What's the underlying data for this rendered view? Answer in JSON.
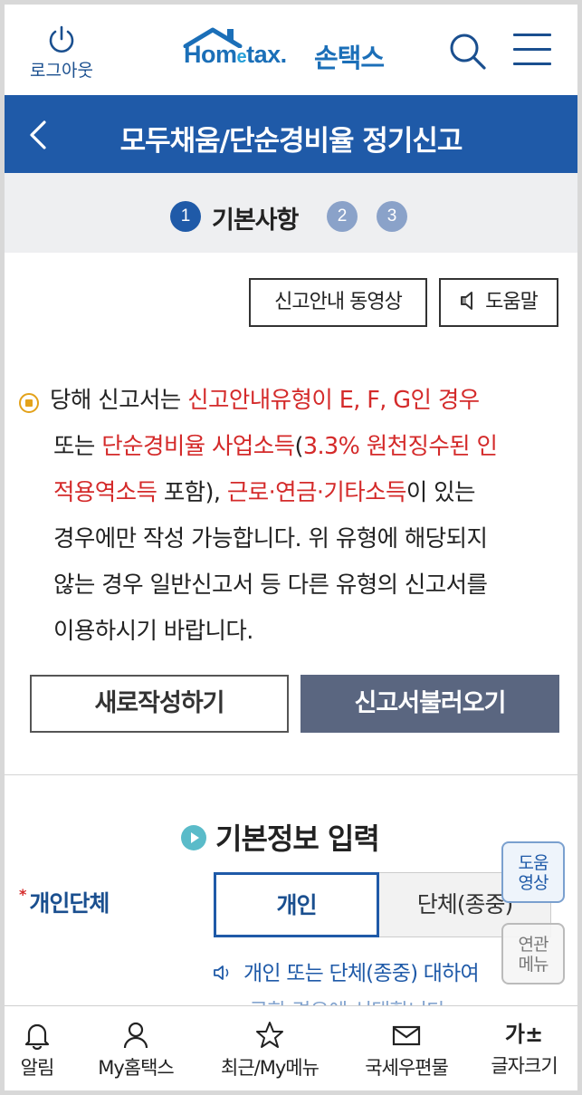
{
  "header": {
    "logout_label": "로그아웃",
    "logo_text_prefix": "Hom",
    "logo_text_e": "e",
    "logo_text_suffix": "tax.",
    "logo_son": "손택스",
    "search_icon": "search-icon",
    "menu_icon": "hamburger-menu-icon"
  },
  "title_bar": {
    "title": "모두채움/단순경비율 정기신고",
    "back_icon": "chevron-left-icon"
  },
  "steps": {
    "items": [
      {
        "number": "1",
        "label": "기본사항",
        "active": true
      },
      {
        "number": "2",
        "active": false
      },
      {
        "number": "3",
        "active": false
      }
    ]
  },
  "help": {
    "video_guide_label": "신고안내 동영상",
    "help_label": "도움말"
  },
  "notice": {
    "line1_a": "당해 신고서는 ",
    "line1_red": "신고안내유형이 E, F, G인 경우",
    "line2_a": "또는 ",
    "line2_red": "단순경비율 사업소득",
    "line2_b": "(",
    "line2_red2": "3.3% 원천징수된 인",
    "line3_red": "적용역소득",
    "line3_a": " 포함), ",
    "line3_red2": "근로·연금·기타소득",
    "line3_b": "이 있는",
    "line4": "경우에만 작성 가능합니다. 위 유형에 해당되지",
    "line5": "않는 경우 일반신고서 등 다른 유형의 신고서를",
    "line6": "이용하시기 바랍니다."
  },
  "actions": {
    "new_label": "새로작성하기",
    "load_label": "신고서불러오기"
  },
  "basic_info": {
    "title": "기본정보 입력",
    "field_label": "개인단체",
    "required_mark": "*",
    "options": [
      "개인",
      "단체(종중)"
    ],
    "selected": "개인",
    "hint_line1": "개인 또는 단체(종중) 대하여 ",
    "hint_line2": "국한 경우에 선택합니다"
  },
  "floating": {
    "video_label_1": "도움",
    "video_label_2": "영상",
    "related_label_1": "연관",
    "related_label_2": "메뉴"
  },
  "bottom_nav": {
    "items": [
      {
        "label": "알림",
        "icon": "bell-icon"
      },
      {
        "label": "My홈택스",
        "icon": "person-icon"
      },
      {
        "label": "최근/My메뉴",
        "icon": "star-icon"
      },
      {
        "label": "국세우편물",
        "icon": "mail-icon"
      },
      {
        "label": "글자크기",
        "icon": "font-size-icon",
        "glyph": "가±"
      }
    ]
  },
  "colors": {
    "primary": "#1f5aa8",
    "accent_red": "#d42a2a",
    "load_button": "#5a6680",
    "step_inactive": "#8aa2c9"
  }
}
